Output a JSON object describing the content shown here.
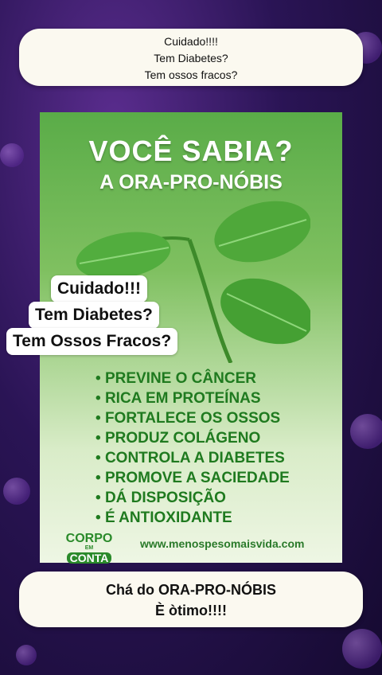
{
  "top_caption": [
    "Cuidado!!!!",
    "Tem Diabetes?",
    "Tem ossos fracos?"
  ],
  "card": {
    "headline": "VOCÊ SABIA?",
    "subheadline": "A ORA-PRO-NÓBIS",
    "benefits": [
      "PREVINE O CÂNCER",
      "RICA EM PROTEÍNAS",
      "FORTALECE OS OSSOS",
      "PRODUZ COLÁGENO",
      "CONTROLA A DIABETES",
      "PROMOVE A SACIEDADE",
      "DÁ DISPOSIÇÃO",
      "É ANTIOXIDANTE"
    ],
    "logo_line1": "CORPO",
    "logo_line2": "EM",
    "logo_line3": "CONTA",
    "website": "www.menospesomaisvida.com"
  },
  "overlay_sticker": [
    "Cuidado!!!",
    "Tem Diabetes?",
    "Tem Ossos Fracos?"
  ],
  "bottom_caption": [
    "Chá do ORA-PRO-NÓBIS",
    "È òtimo!!!!"
  ],
  "colors": {
    "background": "#2a1455",
    "card_green": "#5aac48",
    "text_green": "#1f7a1f",
    "caption_bg": "#fbf9f0"
  },
  "icon": "leaf-illustration"
}
